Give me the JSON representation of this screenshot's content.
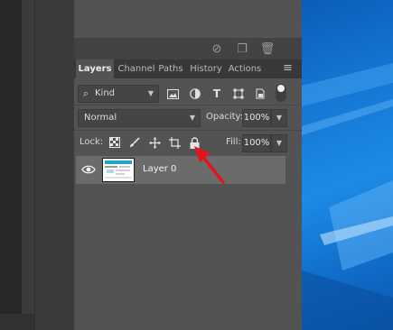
{
  "tabs": [
    {
      "label": "Layers",
      "active": true
    },
    {
      "label": "Channel",
      "active": false
    },
    {
      "label": "Paths",
      "active": false
    },
    {
      "label": "History",
      "active": false
    },
    {
      "label": "Actions",
      "active": false
    }
  ],
  "filter": {
    "kind_label": "Kind",
    "icons": [
      "pixel-filter-icon",
      "adjustment-filter-icon",
      "type-filter-icon",
      "shape-filter-icon",
      "smart-object-filter-icon"
    ],
    "type_icon_text": "T"
  },
  "blend": {
    "mode": "Normal",
    "opacity_label": "Opacity:",
    "opacity_value": "100%"
  },
  "lock": {
    "label": "Lock:",
    "fill_label": "Fill:",
    "fill_value": "100%",
    "icons": [
      "lock-transparent-pixels-icon",
      "lock-image-pixels-icon",
      "lock-position-icon",
      "lock-artboard-icon",
      "lock-all-icon"
    ]
  },
  "layers": [
    {
      "name": "Layer 0",
      "visible": true
    }
  ],
  "colors": {
    "panel_bg": "#535353",
    "tab_bar_bg": "#383838",
    "selected_row": "#6b6b6b",
    "annotation": "#e4141b",
    "wallpaper": "#1478d4"
  }
}
